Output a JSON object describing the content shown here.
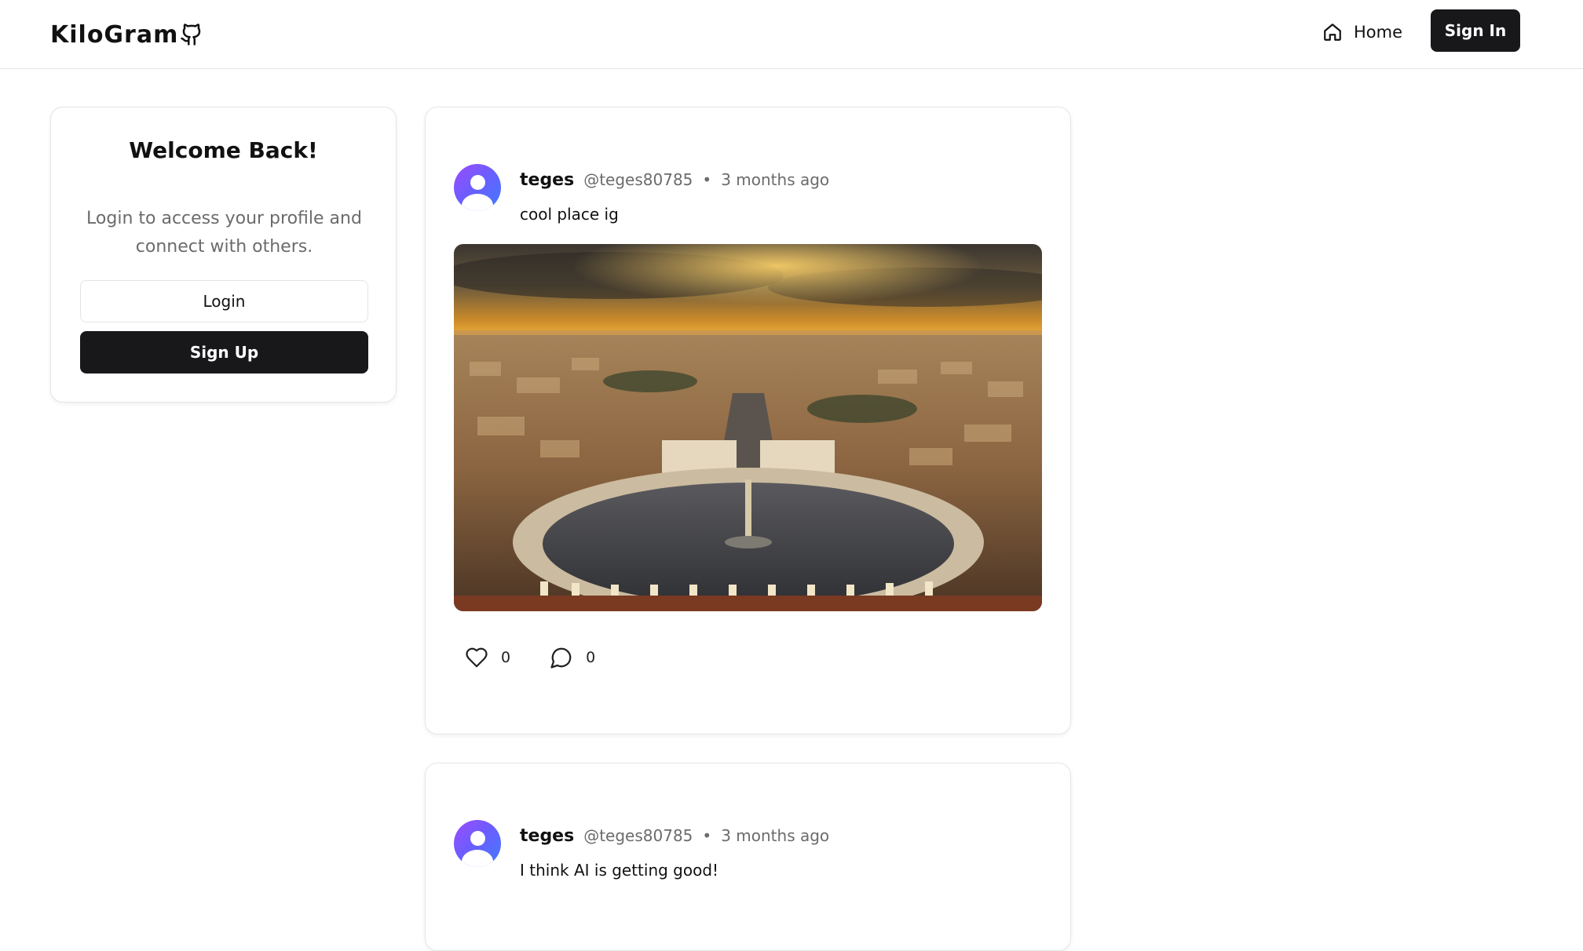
{
  "header": {
    "brand": "KiloGram",
    "brand_icon": "github-icon",
    "home_label": "Home",
    "home_icon": "home-icon",
    "signin_label": "Sign In"
  },
  "welcome": {
    "title": "Welcome Back!",
    "subtitle": "Login to access your profile and connect with others.",
    "login_label": "Login",
    "signup_label": "Sign Up"
  },
  "posts": [
    {
      "username": "teges",
      "handle": "@teges80785",
      "separator": "•",
      "time": "3 months ago",
      "text": "cool place ig",
      "has_image": true,
      "likes": "0",
      "comments": "0"
    },
    {
      "username": "teges",
      "handle": "@teges80785",
      "separator": "•",
      "time": "3 months ago",
      "text": "I think AI is getting good!",
      "has_image": false
    }
  ],
  "colors": {
    "primary_button": "#18181b",
    "border": "#e5e5e5",
    "muted_text": "#6b6b6b",
    "avatar_gradient_start": "#9b4dff",
    "avatar_gradient_end": "#3f7bff"
  }
}
